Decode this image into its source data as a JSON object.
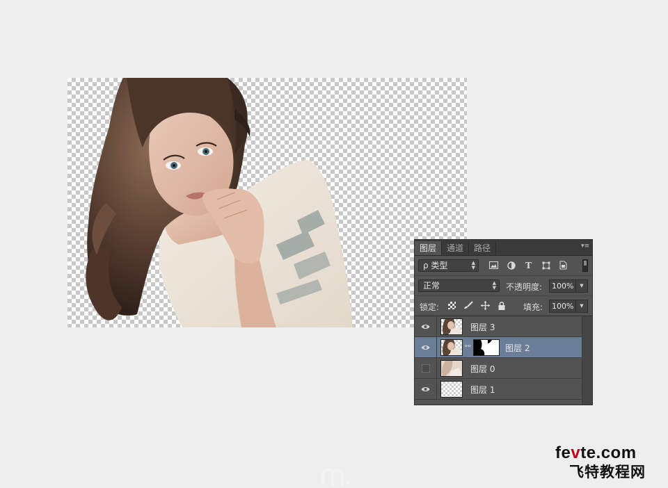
{
  "panel": {
    "tabs": [
      {
        "label": "图层",
        "active": true
      },
      {
        "label": "通道",
        "active": false
      },
      {
        "label": "路径",
        "active": false
      }
    ],
    "filter": {
      "label": "ρ 类型"
    },
    "blend_mode": "正常",
    "opacity_label": "不透明度:",
    "opacity_value": "100%",
    "lock_label": "锁定:",
    "fill_label": "填充:",
    "fill_value": "100%",
    "layers": [
      {
        "name": "图层 3",
        "visible": true,
        "selected": false,
        "has_mask": false
      },
      {
        "name": "图层 2",
        "visible": true,
        "selected": true,
        "has_mask": true
      },
      {
        "name": "图层 0",
        "visible": false,
        "selected": false,
        "has_mask": false
      },
      {
        "name": "图层 1",
        "visible": true,
        "selected": false,
        "has_mask": false
      }
    ],
    "colors": {
      "panel_bg": "#535353",
      "selected_row": "#6a7e98"
    }
  },
  "watermark": {
    "url_part1": "fe",
    "url_part2": "v",
    "url_part3": "te.com",
    "cn": "飞特教程网"
  },
  "icons": {
    "filter_icons": [
      "image-filter-icon",
      "adjustment-filter-icon",
      "type-filter-icon",
      "shape-filter-icon",
      "smart-object-filter-icon"
    ],
    "lock_icons": [
      "lock-transparency-icon",
      "lock-pixels-icon",
      "lock-position-icon",
      "lock-all-icon"
    ]
  }
}
